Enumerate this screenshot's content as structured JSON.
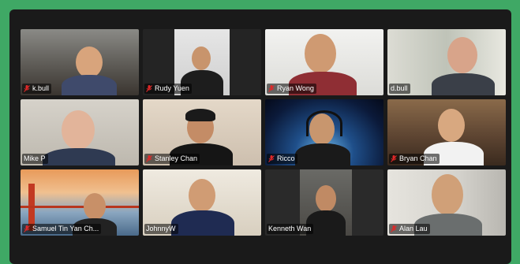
{
  "app": {
    "view": "gallery"
  },
  "colors": {
    "background": "#3fa865",
    "frame": "#1a1a1a",
    "muted_mic": "#e02828"
  },
  "participants": [
    {
      "name": "k.bull",
      "muted": true
    },
    {
      "name": "Rudy Yuen",
      "muted": true
    },
    {
      "name": "Ryan Wong",
      "muted": true
    },
    {
      "name": "d.bull",
      "muted": false
    },
    {
      "name": "Mike P",
      "muted": false
    },
    {
      "name": "Stanley Chan",
      "muted": true
    },
    {
      "name": "Ricco",
      "muted": true
    },
    {
      "name": "Bryan Chan",
      "muted": true
    },
    {
      "name": "Samuel Tin Yan Ch...",
      "muted": true
    },
    {
      "name": "JohnnyW",
      "muted": false
    },
    {
      "name": "Kenneth Wan",
      "muted": false
    },
    {
      "name": "Alan Lau",
      "muted": true
    }
  ]
}
